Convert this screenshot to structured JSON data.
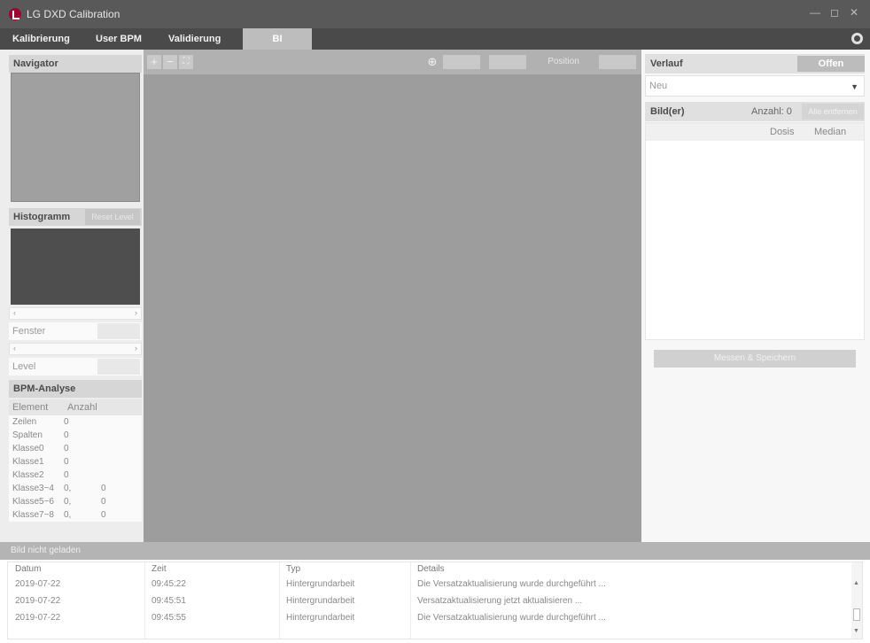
{
  "window": {
    "title": "LG DXD Calibration",
    "controls": {
      "minimize": "—",
      "maximize": "◻",
      "close": "✕"
    }
  },
  "tabs": [
    {
      "label": "Kalibrierung"
    },
    {
      "label": "User BPM"
    },
    {
      "label": "Validierung"
    },
    {
      "label": "BI"
    }
  ],
  "left": {
    "navigator_title": "Navigator",
    "histogram_title": "Histogramm",
    "histogram_reset": "Reset Level",
    "slider_left": "‹",
    "slider_right": "›",
    "window_label": "Fenster",
    "level_label": "Level",
    "bpm_title": "BPM-Analyse",
    "bpm_headers": {
      "element": "Element",
      "count": "Anzahl"
    },
    "bpm_rows": [
      {
        "name": "Zeilen",
        "count": "0",
        "extra": ""
      },
      {
        "name": "Spalten",
        "count": "0",
        "extra": ""
      },
      {
        "name": "Klasse0",
        "count": "0",
        "extra": ""
      },
      {
        "name": "Klasse1",
        "count": "0",
        "extra": ""
      },
      {
        "name": "Klasse2",
        "count": "0",
        "extra": ""
      },
      {
        "name": "Klasse3~4",
        "count": "0,",
        "extra": "0"
      },
      {
        "name": "Klasse5~6",
        "count": "0,",
        "extra": "0"
      },
      {
        "name": "Klasse7~8",
        "count": "0,",
        "extra": "0"
      }
    ]
  },
  "toolbar": {
    "zoom_in": "+",
    "zoom_out": "−",
    "fit": "⛶",
    "position_label": "Position"
  },
  "right": {
    "history_title": "Verlauf",
    "open_button": "Offen",
    "select_value": "Neu",
    "images_title": "Bild(er)",
    "count_label": "Anzahl: 0",
    "analyze_button": "Alle entfernen",
    "columns": {
      "dose": "Dosis",
      "median": "Median"
    },
    "save_button": "Messen & Speichern"
  },
  "status": {
    "text": "Bild nicht geladen"
  },
  "log": {
    "headers": {
      "date": "Datum",
      "time": "Zeit",
      "type": "Typ",
      "details": "Details"
    },
    "rows": [
      {
        "date": "2019-07-22",
        "time": "09:45:22",
        "type": "Hintergrundarbeit",
        "details": "Die Versatzaktualisierung wurde durchgeführt ..."
      },
      {
        "date": "2019-07-22",
        "time": "09:45:51",
        "type": "Hintergrundarbeit",
        "details": "Versatzaktualisierung jetzt aktualisieren ..."
      },
      {
        "date": "2019-07-22",
        "time": "09:45:55",
        "type": "Hintergrundarbeit",
        "details": "Die Versatzaktualisierung wurde durchgeführt ..."
      }
    ]
  },
  "colors": {
    "titlebar": "#595959",
    "tabbar": "#4a4a4a",
    "viewer": "#9d9d9d",
    "brand": "#a50034"
  },
  "icons": {
    "logo": "lg-logo-icon",
    "settings": "gear-icon",
    "select_caret": "chevron-down-icon"
  }
}
